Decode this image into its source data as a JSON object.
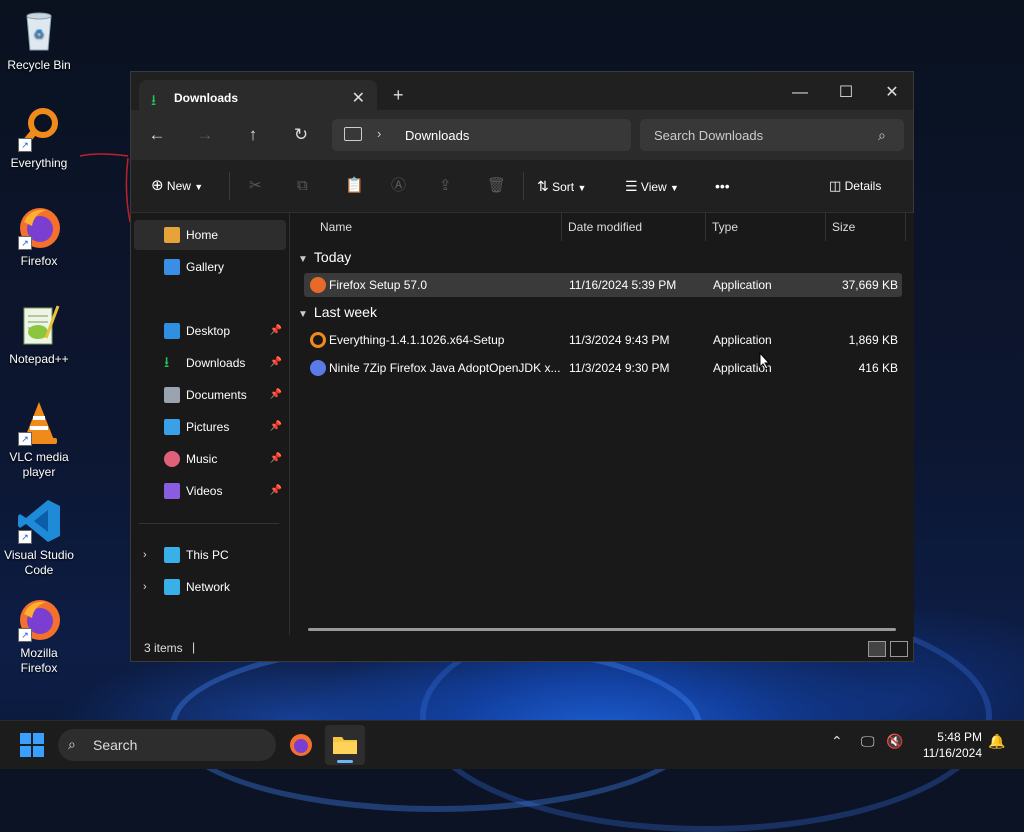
{
  "desktop": {
    "icons": [
      {
        "label": "Recycle Bin",
        "icon": "recycle-bin-icon"
      },
      {
        "label": "Everything",
        "icon": "everything-icon"
      },
      {
        "label": "Firefox",
        "icon": "firefox-icon"
      },
      {
        "label": "Notepad++",
        "icon": "notepad-plus-plus-icon"
      },
      {
        "label": "VLC media player",
        "icon": "vlc-icon"
      },
      {
        "label": "Visual Studio Code",
        "icon": "vscode-icon"
      },
      {
        "label": "Mozilla Firefox",
        "icon": "firefox-icon"
      }
    ]
  },
  "window": {
    "tab_title": "Downloads",
    "tab_close": "✕",
    "new_tab": "+",
    "controls": {
      "minimize": "—",
      "maximize": "☐",
      "close": "✕"
    }
  },
  "nav": {
    "back": "←",
    "forward": "→",
    "up": "↑",
    "refresh": "↻",
    "breadcrumb": "Downloads",
    "search_placeholder": "Search Downloads"
  },
  "toolbar": {
    "new_label": "New",
    "sort_label": "Sort",
    "view_label": "View",
    "more_label": "•••",
    "details_label": "Details"
  },
  "sidebar": {
    "items": [
      {
        "label": "Home",
        "icon": "home-icon",
        "color": "#e8a23a"
      },
      {
        "label": "Gallery",
        "icon": "gallery-icon",
        "color": "#3a8ee6"
      },
      {
        "label": "Desktop",
        "icon": "desktop-icon",
        "color": "#2f8fe0",
        "pinned": true
      },
      {
        "label": "Downloads",
        "icon": "downloads-icon",
        "color": "#22c35a",
        "pinned": true
      },
      {
        "label": "Documents",
        "icon": "documents-icon",
        "color": "#9aa4b0",
        "pinned": true
      },
      {
        "label": "Pictures",
        "icon": "pictures-icon",
        "color": "#3aa0e8",
        "pinned": true
      },
      {
        "label": "Music",
        "icon": "music-icon",
        "color": "#e0607a",
        "pinned": true
      },
      {
        "label": "Videos",
        "icon": "videos-icon",
        "color": "#8a5ce0",
        "pinned": true
      },
      {
        "label": "This PC",
        "icon": "this-pc-icon",
        "color": "#3ab0e8"
      },
      {
        "label": "Network",
        "icon": "network-icon",
        "color": "#3ab0e8"
      }
    ]
  },
  "columns": [
    "Name",
    "Date modified",
    "Type",
    "Size"
  ],
  "groups": [
    {
      "label": "Today",
      "files": [
        {
          "name": "Firefox Setup 57.0",
          "date": "11/16/2024 5:39 PM",
          "type": "Application",
          "size": "37,669 KB",
          "icon": "firefox-installer-icon",
          "color": "#e86a2a",
          "selected": true
        }
      ]
    },
    {
      "label": "Last week",
      "files": [
        {
          "name": "Everything-1.4.1.1026.x64-Setup",
          "date": "11/3/2024 9:43 PM",
          "type": "Application",
          "size": "1,869 KB",
          "icon": "everything-installer-icon",
          "color": "#f08a1a"
        },
        {
          "name": "Ninite 7Zip Firefox Java AdoptOpenJDK x...",
          "date": "11/3/2024 9:30 PM",
          "type": "Application",
          "size": "416 KB",
          "icon": "ninite-icon",
          "color": "#5a7ae8"
        }
      ]
    }
  ],
  "status": {
    "item_count": "3 items"
  },
  "taskbar": {
    "search_label": "Search",
    "time": "5:48 PM",
    "date": "11/16/2024"
  }
}
